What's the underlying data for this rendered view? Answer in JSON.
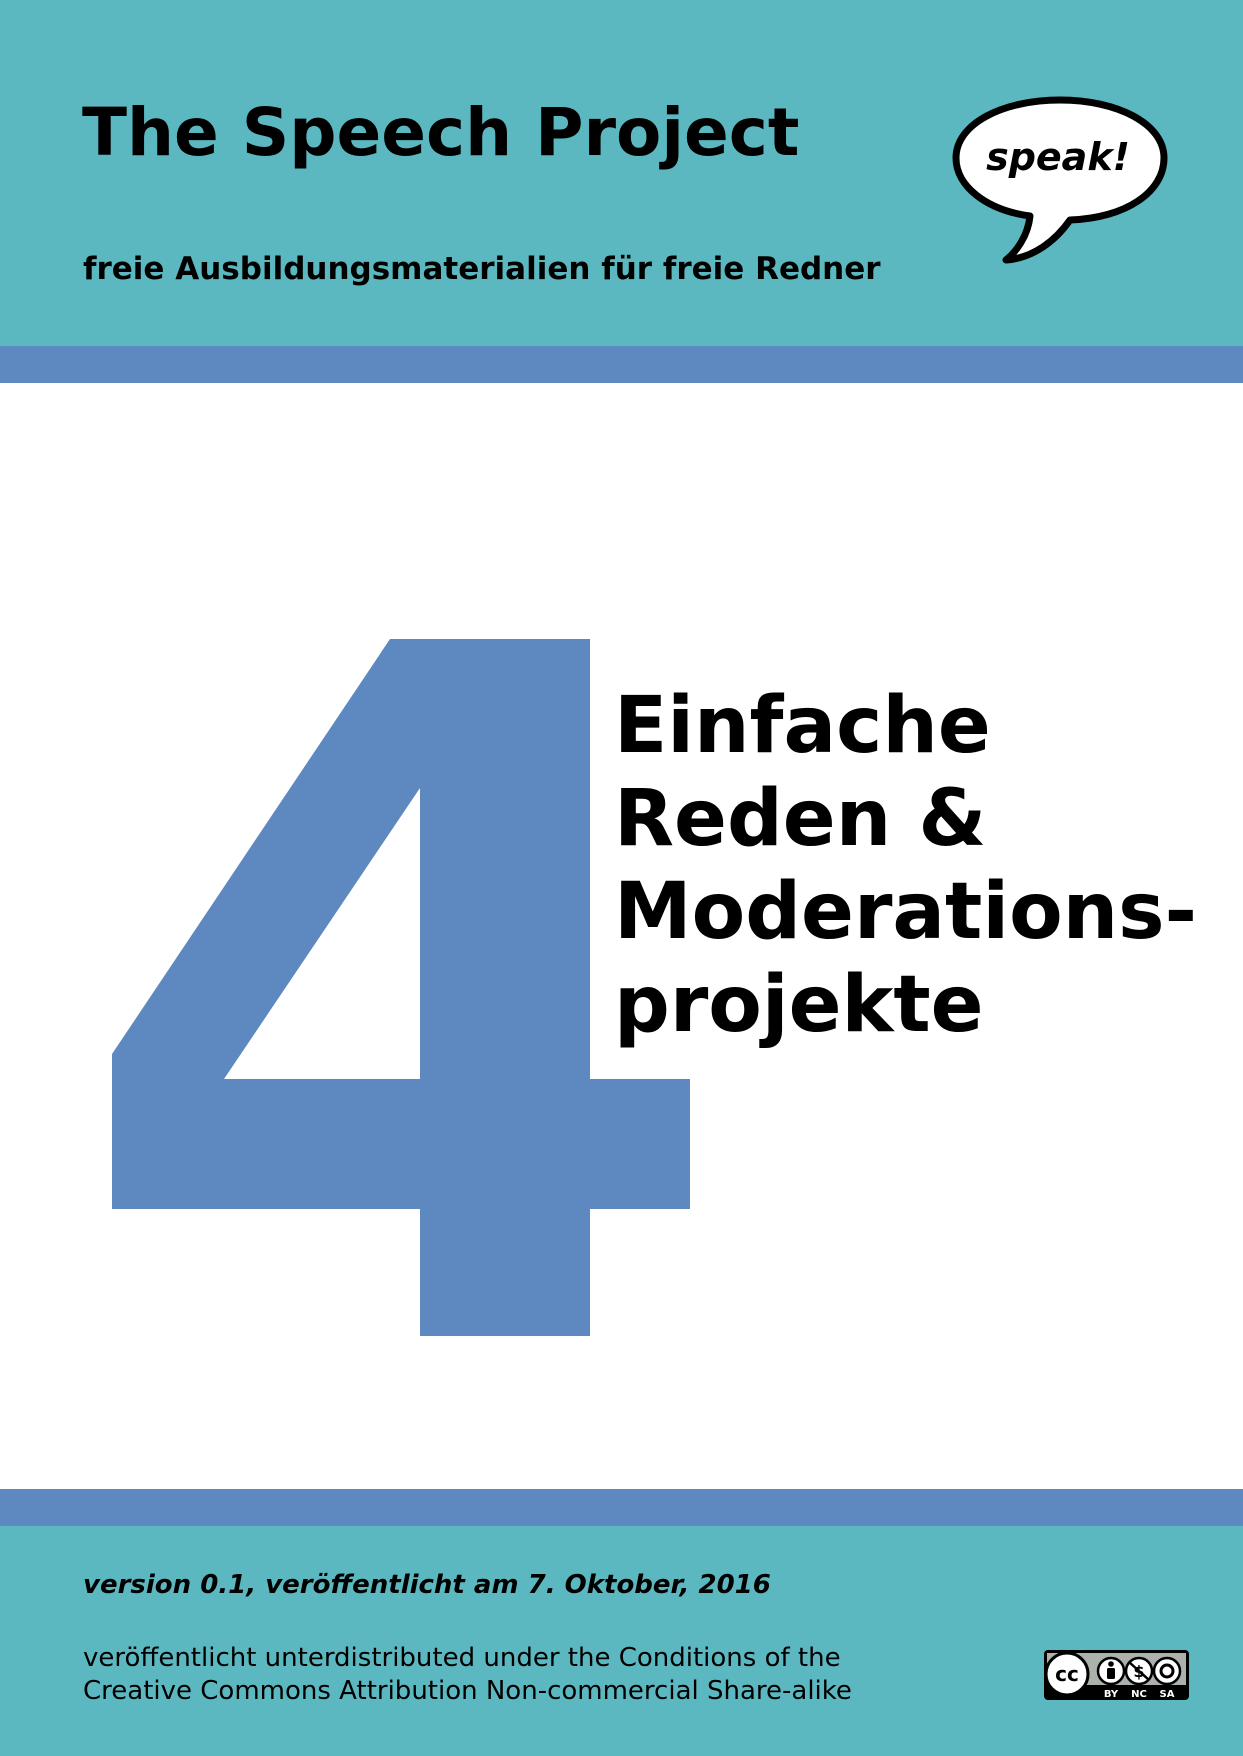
{
  "header": {
    "title": "The Speech Project",
    "subtitle": "freie Ausbildungsmaterialien für freie Redner",
    "bubble_text": "speak!"
  },
  "main": {
    "number": "4",
    "heading_lines": [
      "Einfache",
      "Reden &",
      "Moderations-",
      "projekte"
    ]
  },
  "footer": {
    "version": "version 0.1, veröffentlicht am 7. Oktober, 2016",
    "license_lines": [
      "veröffentlicht unterdistributed under the Conditions of the",
      "Creative Commons Attribution Non-commercial Share-alike"
    ],
    "badge_labels": [
      "BY",
      "NC",
      "SA"
    ],
    "badge_cc": "cc"
  },
  "colors": {
    "teal": "#5cb8c0",
    "blue": "#5e89c0",
    "black": "#000000"
  },
  "icons": [
    "speech-bubble-icon",
    "creative-commons-icon"
  ]
}
